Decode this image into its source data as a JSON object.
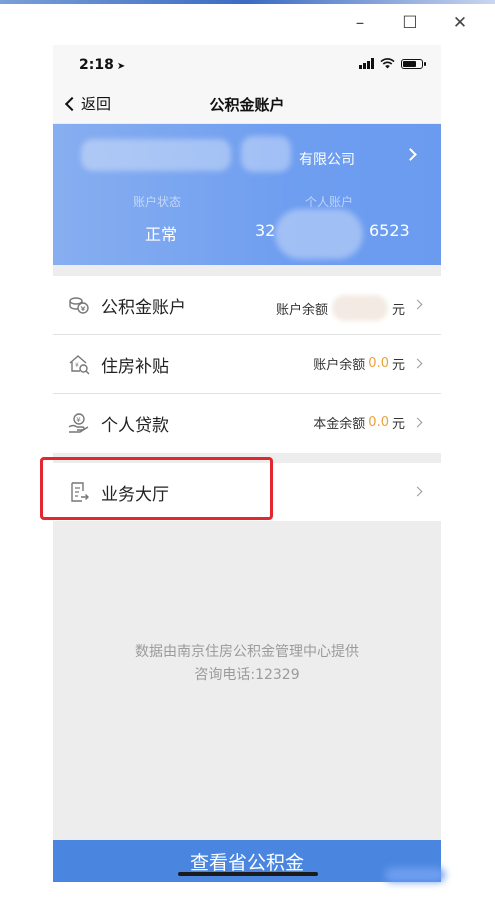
{
  "window": {
    "minimize": "–",
    "maximize": "☐",
    "close": "✕"
  },
  "statusbar": {
    "time": "2:18",
    "location_glyph": "➤"
  },
  "navbar": {
    "back_label": "返回",
    "title": "公积金账户"
  },
  "account_card": {
    "company_suffix": "有限公司",
    "status_label": "账户状态",
    "status_value": "正常",
    "account_label": "个人账户",
    "account_prefix": "32",
    "account_suffix": "6523"
  },
  "list": [
    {
      "label": "公积金账户",
      "right_prefix": "账户余额",
      "amount": "",
      "unit": "元",
      "icon": "coins-icon"
    },
    {
      "label": "住房补贴",
      "right_prefix": "账户余额",
      "amount": "0.0",
      "unit": "元",
      "icon": "house-subsidy-icon"
    },
    {
      "label": "个人贷款",
      "right_prefix": "本金余额",
      "amount": "0.0",
      "unit": "元",
      "icon": "loan-hand-icon"
    }
  ],
  "hall": {
    "label": "业务大厅",
    "icon": "document-arrow-icon"
  },
  "footer": {
    "line1": "数据由南京住房公积金管理中心提供",
    "line2": "咨询电话:12329"
  },
  "bottom_button": {
    "label": "查看省公积金"
  },
  "colors": {
    "card_blue": "#6f9ef0",
    "button_blue": "#4a86e0",
    "amount_orange": "#e9a23b",
    "highlight_red": "#e3272e"
  }
}
